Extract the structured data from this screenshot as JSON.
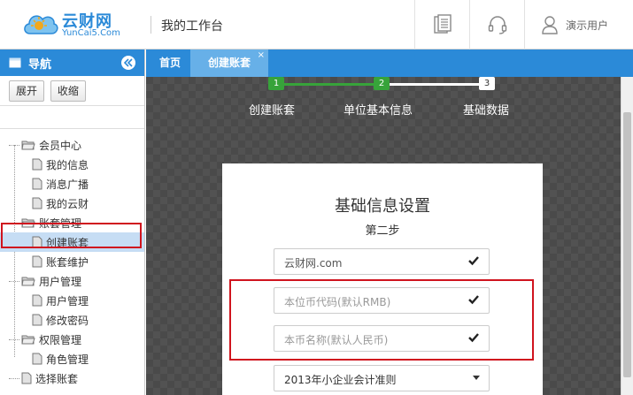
{
  "header": {
    "logo_title": "云财网",
    "logo_sub": "YunCai5.Com",
    "workspace_title": "我的工作台",
    "user_name": "演示用户"
  },
  "sidebar": {
    "title": "导航",
    "expand_label": "展开",
    "collapse_label": "收缩",
    "tree": [
      {
        "label": "会员中心",
        "children": [
          "我的信息",
          "消息广播",
          "我的云财"
        ]
      },
      {
        "label": "账套管理",
        "children": [
          "创建账套",
          "账套维护"
        ]
      },
      {
        "label": "用户管理",
        "children": [
          "用户管理",
          "修改密码"
        ]
      },
      {
        "label": "权限管理",
        "children": [
          "角色管理"
        ]
      },
      {
        "label": "选择账套",
        "children": []
      }
    ],
    "selected": "创建账套"
  },
  "tabs": {
    "home": "首页",
    "active": "创建账套",
    "close": "×"
  },
  "steps": [
    {
      "number": "1",
      "label": "创建账套",
      "state": "done"
    },
    {
      "number": "2",
      "label": "单位基本信息",
      "state": "current"
    },
    {
      "number": "3",
      "label": "基础数据",
      "state": "todo"
    }
  ],
  "form": {
    "title": "基础信息设置",
    "subtitle": "第二步",
    "domain_value": "云财网.com",
    "currency_code_placeholder": "本位币代码(默认RMB)",
    "currency_name_placeholder": "本币名称(默认人民币)",
    "accounting_standard": "2013年小企业会计准则"
  },
  "colors": {
    "brand_blue": "#2b8ad8",
    "step_green": "#37a33a",
    "highlight_red": "#d0141e"
  }
}
